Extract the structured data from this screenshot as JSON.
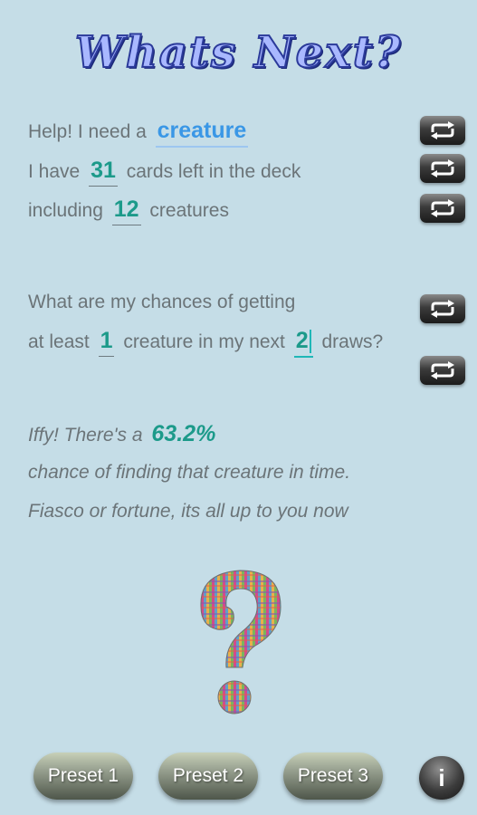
{
  "app": {
    "title": "Whats Next?"
  },
  "help": {
    "prefix": "Help! I need a",
    "card_type": "creature",
    "have_prefix": "I have",
    "deck_count": "31",
    "have_suffix": "cards left in the deck",
    "including": "including",
    "type_count": "12",
    "type_plural": "creatures"
  },
  "question": {
    "line1": "What are my chances of getting",
    "at_least": "at least",
    "min_count": "1",
    "mid": "creature in my next",
    "draws": "2",
    "suffix": "draws?"
  },
  "result": {
    "prefix": "Iffy! There's a",
    "percent": "63.2%",
    "line2": "chance of finding that creature in time.",
    "line3": "Fiasco or fortune, its all up to you now"
  },
  "buttons": {
    "preset1": "Preset 1",
    "preset2": "Preset 2",
    "preset3": "Preset 3",
    "info": "i"
  },
  "icons": {
    "refresh": "refresh-icon",
    "question": "question-mark-icon"
  }
}
